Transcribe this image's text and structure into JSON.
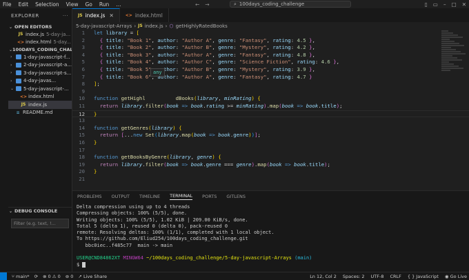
{
  "titlebar": {
    "menus": [
      "File",
      "Edit",
      "Selection",
      "View",
      "Go",
      "Run",
      "…"
    ],
    "search": "100days_coding_challenge"
  },
  "sidebar": {
    "title": "EXPLORER",
    "open_editors_label": "OPEN EDITORS",
    "open_editors": [
      {
        "name": "index.js",
        "hint": "5-day-ja...",
        "kind": "js"
      },
      {
        "name": "index.html",
        "hint": "5-day...",
        "kind": "html"
      }
    ],
    "project_label": "100DAYS_CODING_CHALLE...",
    "folders": [
      {
        "name": "1-day-javascript-f..."
      },
      {
        "name": "2-day-javascript-a..."
      },
      {
        "name": "3-day-javascript-s..."
      },
      {
        "name": "4-day-javas..."
      },
      {
        "name": "5-day-javascript-..."
      }
    ],
    "files": [
      {
        "name": "index.html",
        "kind": "html"
      },
      {
        "name": "index.js",
        "kind": "js"
      },
      {
        "name": "README.md",
        "kind": "md"
      }
    ],
    "debug_label": "DEBUG CONSOLE",
    "filter_placeholder": "Filter (e.g. text, !..."
  },
  "editor": {
    "tabs": [
      {
        "label": "index.js",
        "kind": "js",
        "active": true
      },
      {
        "label": "index.html",
        "kind": "html",
        "active": false
      }
    ],
    "breadcrumb": [
      "5-day-javascript-Arrays",
      "index.js",
      "getHighlyRatedBooks"
    ],
    "hover": "any",
    "lines": [
      {
        "n": "1",
        "html": "<span class='k'>let</span> <span class='v'>library</span> = <span class='br1'>[</span>"
      },
      {
        "n": "2",
        "html": "  <span class='br2'>{</span> <span class='v'>title</span>: <span class='s'>\"Book 1\"</span>, <span class='v'>author</span>: <span class='s'>\"Author A\"</span>, <span class='v'>genre</span>: <span class='s'>\"Fantasy\"</span>, <span class='v'>rating</span>: <span class='n'>4.5</span> <span class='br2'>}</span>,"
      },
      {
        "n": "3",
        "html": "  <span class='br2'>{</span> <span class='v'>title</span>: <span class='s'>\"Book 2\"</span>, <span class='v'>author</span>: <span class='s'>\"Author B\"</span>, <span class='v'>genre</span>: <span class='s'>\"Mystery\"</span>, <span class='v'>rating</span>: <span class='n'>4.2</span> <span class='br2'>}</span>,"
      },
      {
        "n": "4",
        "html": "  <span class='br2'>{</span> <span class='v'>title</span>: <span class='s'>\"Book 3\"</span>, <span class='v'>author</span>: <span class='s'>\"Author A\"</span>, <span class='v'>genre</span>: <span class='s'>\"Fantasy\"</span>, <span class='v'>rating</span>: <span class='n'>4.8</span> <span class='br2'>}</span>,"
      },
      {
        "n": "5",
        "html": "  <span class='br2'>{</span> <span class='v'>title</span>: <span class='s'>\"Book 4\"</span>, <span class='v'>author</span>: <span class='s'>\"Author C\"</span>, <span class='v'>genre</span>: <span class='s'>\"Science Fiction\"</span>, <span class='v'>rating</span>: <span class='n'>4.6</span> <span class='br2'>}</span>,"
      },
      {
        "n": "6",
        "html": "  <span class='br2'>{</span> <span class='v'>title</span>: <span class='s'>\"Book 5\"</span>, <span class='v'>author</span>: <span class='s'>\"Author B\"</span>, <span class='v'>genre</span>: <span class='s'>\"Mystery\"</span>, <span class='v'>rating</span>: <span class='n'>3.9</span> <span class='br2'>}</span>,"
      },
      {
        "n": "7",
        "html": "  <span class='br2'>{</span> <span class='v'>title</span>: <span class='s'>\"Book 6\"</span>, <span class='v'>author</span>: <span class='s'>\"Author A\"</span>, <span class='v'>genre</span>: <span class='s'>\"Fantasy\"</span>, <span class='v'>rating</span>: <span class='n'>4.7</span> <span class='br2'>}</span>"
      },
      {
        "n": "8",
        "html": "<span class='br1'>]</span>;"
      },
      {
        "n": "9",
        "html": ""
      },
      {
        "n": "10",
        "html": "<span class='k'>function</span> <span class='f'>getHighl</span>          <span class='f'>dBooks</span><span class='br1'>(</span><span class='pv'>library</span>, <span class='pv'>minRating</span><span class='br1'>)</span> <span class='br1'>{</span>"
      },
      {
        "n": "11",
        "html": "  <span class='kf'>return</span> <span class='pv'>library</span>.<span class='f'>filter</span><span class='br2'>(</span><span class='pv'>book</span> <span class='k'>=&gt;</span> <span class='pv'>book</span>.<span class='v'>rating</span> &gt;= <span class='pv'>minRating</span><span class='br2'>)</span>.<span class='f'>map</span><span class='br2'>(</span><span class='pv'>book</span> <span class='k'>=&gt;</span> <span class='pv'>book</span>.<span class='v'>title</span><span class='br2'>)</span>;"
      },
      {
        "n": "12",
        "html": "<span class='br1'>}</span>",
        "current": true
      },
      {
        "n": "13",
        "html": ""
      },
      {
        "n": "14",
        "html": "<span class='k'>function</span> <span class='f'>getGenres</span><span class='br1'>(</span><span class='pv'>library</span><span class='br1'>)</span> <span class='br1'>{</span>"
      },
      {
        "n": "15",
        "html": "  <span class='kf'>return</span> <span class='br2'>[</span>...<span class='k'>new</span> <span class='f'>Set</span><span class='br3'>(</span><span class='pv'>library</span>.<span class='f'>map</span><span class='br1'>(</span><span class='pv'>book</span> <span class='k'>=&gt;</span> <span class='pv'>book</span>.<span class='v'>genre</span><span class='br1'>)</span><span class='br3'>)</span><span class='br2'>]</span>;"
      },
      {
        "n": "16",
        "html": "<span class='br1'>}</span>"
      },
      {
        "n": "17",
        "html": ""
      },
      {
        "n": "18",
        "html": "<span class='k'>function</span> <span class='f'>getBooksByGenre</span><span class='br1'>(</span><span class='pv'>library</span>, <span class='pv'>genre</span><span class='br1'>)</span> <span class='br1'>{</span>"
      },
      {
        "n": "19",
        "html": "  <span class='kf'>return</span> <span class='pv'>library</span>.<span class='f'>filter</span><span class='br2'>(</span><span class='pv'>book</span> <span class='k'>=&gt;</span> <span class='pv'>book</span>.<span class='v'>genre</span> === <span class='pv'>genre</span><span class='br2'>)</span>.<span class='f'>map</span><span class='br2'>(</span><span class='pv'>book</span> <span class='k'>=&gt;</span> <span class='pv'>book</span>.<span class='v'>title</span><span class='br2'>)</span>;"
      },
      {
        "n": "20",
        "html": "<span class='br1'>}</span>"
      },
      {
        "n": "21",
        "html": ""
      }
    ]
  },
  "panel": {
    "tabs": [
      "PROBLEMS",
      "OUTPUT",
      "TIMELINE",
      "TERMINAL",
      "PORTS",
      "GITLENS"
    ],
    "active_tab": "TERMINAL",
    "terminal_lines": [
      "Delta compression using up to 4 threads",
      "Compressing objects: 100% (5/5), done.",
      "Writing objects: 100% (5/5), 1.02 KiB | 209.00 KiB/s, done.",
      "Total 5 (delta 1), reused 0 (delta 0), pack-reused 0",
      "remote: Resolving deltas: 100% (1/1), completed with 1 local object.",
      "To https://github.com/Eliud254/100days_coding_challenge.git",
      "   bbc0iec..f485c77  main -> main",
      ""
    ],
    "prompt_user": "USER@CND84862XT",
    "prompt_shell": "MINGW64",
    "prompt_path": "~/100days_coding_challenge/5-day-javascript-Arrays",
    "prompt_branch": "(main)",
    "prompt_input": "$ "
  },
  "statusbar": {
    "branch": "main*",
    "errors": "0",
    "warnings": "0",
    "ports": "0",
    "live_share": "Live Share",
    "position": "Ln 12, Col 2",
    "spaces": "Spaces: 2",
    "encoding": "UTF-8",
    "eol": "CRLF",
    "language": "JavaScript",
    "go_live": "Go Live"
  }
}
